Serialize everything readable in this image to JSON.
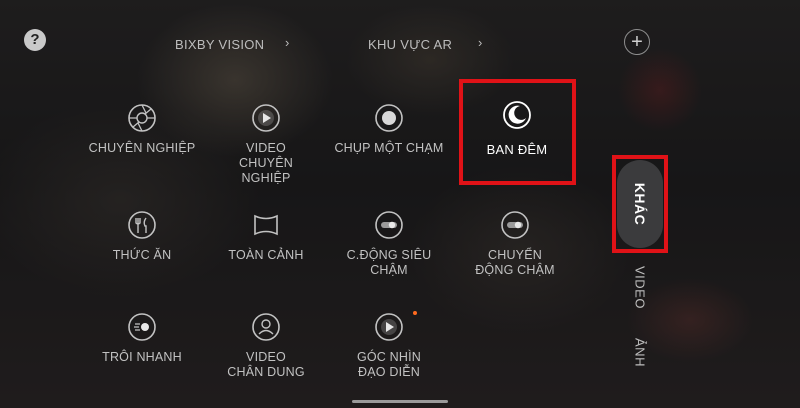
{
  "top": {
    "help_label": "?",
    "bixby_label": "BIXBY VISION",
    "ar_label": "KHU VỰC AR",
    "chevron": "›",
    "plus_label": "+"
  },
  "modes": [
    {
      "label": "CHUYÊN NGHIỆP",
      "icon": "aperture-icon"
    },
    {
      "label": "VIDEO CHUYÊN NGHIỆP",
      "icon": "video-pro-icon"
    },
    {
      "label": "CHỤP MỘT CHẠM",
      "icon": "single-take-icon"
    },
    {
      "label": "BAN ĐÊM",
      "icon": "moon-icon",
      "active": true
    },
    {
      "label": "THỨC ĂN",
      "icon": "food-icon"
    },
    {
      "label": "TOÀN CẢNH",
      "icon": "panorama-icon"
    },
    {
      "label": "C.ĐỘNG SIÊU CHẬM",
      "icon": "super-slow-mo-icon"
    },
    {
      "label": "CHUYỂN ĐỘNG CHẬM",
      "icon": "slow-mo-icon"
    },
    {
      "label": "TRÔI NHANH",
      "icon": "hyperlapse-icon"
    },
    {
      "label": "VIDEO CHÂN DUNG",
      "icon": "portrait-video-icon"
    },
    {
      "label": "GÓC NHÌN ĐẠO DIỄN",
      "icon": "directors-view-icon"
    }
  ],
  "side_tabs": {
    "active": "KHÁC",
    "video": "VIDEO",
    "photo": "ẢNH"
  },
  "colors": {
    "highlight": "#e01217",
    "text": "#c2c2c2",
    "recording_dot": "#ff6a1f"
  }
}
